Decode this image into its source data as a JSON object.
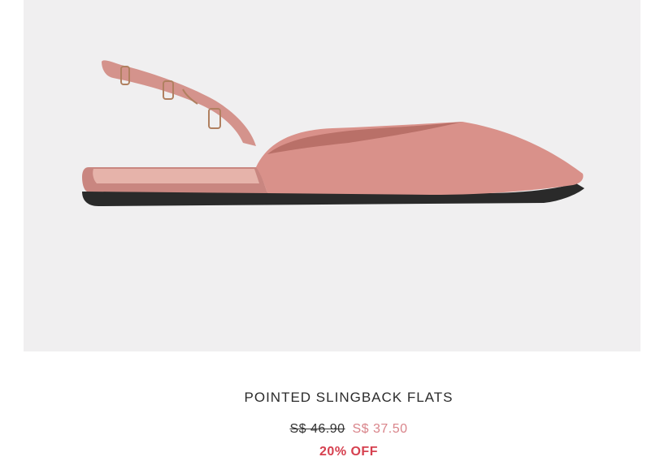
{
  "product": {
    "image_icon": "shoe-image",
    "name": "POINTED SLINGBACK FLATS",
    "original_price": "S$ 46.90",
    "sale_price": "S$ 37.50",
    "discount_label": "20% OFF"
  },
  "colors": {
    "shoe": "#d9918a",
    "sale_price": "#d9848a",
    "discount": "#d6404f",
    "image_background": "#f0eff0"
  }
}
